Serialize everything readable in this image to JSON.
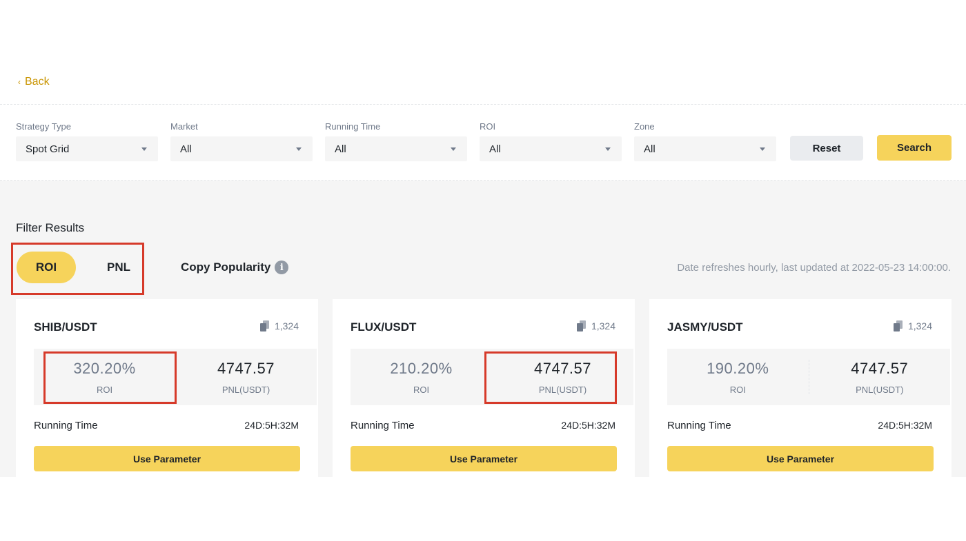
{
  "nav": {
    "back_label": "Back"
  },
  "filters": [
    {
      "label": "Strategy Type",
      "value": "Spot Grid"
    },
    {
      "label": "Market",
      "value": "All"
    },
    {
      "label": "Running Time",
      "value": "All"
    },
    {
      "label": "ROI",
      "value": "All"
    },
    {
      "label": "Zone",
      "value": "All"
    }
  ],
  "buttons": {
    "reset": "Reset",
    "search": "Search"
  },
  "results": {
    "title": "Filter Results",
    "tabs": {
      "roi": "ROI",
      "pnl": "PNL",
      "copy_popularity": "Copy Popularity"
    },
    "active_tab": "ROI",
    "updated_text": "Date refreshes hourly, last updated at 2022-05-23 14:00:00."
  },
  "cards": [
    {
      "pair": "SHIB/USDT",
      "copies": "1,324",
      "roi": "320.20%",
      "roi_label": "ROI",
      "pnl": "4747.57",
      "pnl_label": "PNL(USDT)",
      "running_label": "Running Time",
      "running_value": "24D:5H:32M",
      "button": "Use Parameter"
    },
    {
      "pair": "FLUX/USDT",
      "copies": "1,324",
      "roi": "210.20%",
      "roi_label": "ROI",
      "pnl": "4747.57",
      "pnl_label": "PNL(USDT)",
      "running_label": "Running Time",
      "running_value": "24D:5H:32M",
      "button": "Use Parameter"
    },
    {
      "pair": "JASMY/USDT",
      "copies": "1,324",
      "roi": "190.20%",
      "roi_label": "ROI",
      "pnl": "4747.57",
      "pnl_label": "PNL(USDT)",
      "running_label": "Running Time",
      "running_value": "24D:5H:32M",
      "button": "Use Parameter"
    }
  ],
  "icons": {
    "back": "chevron-left-icon",
    "dropdown": "caret-down-icon",
    "info": "info-icon",
    "copies": "copy-icon"
  },
  "colors": {
    "accent": "#f6d35b",
    "link": "#c99400",
    "highlight": "#d63a2a",
    "panel_bg": "#f5f5f5"
  }
}
